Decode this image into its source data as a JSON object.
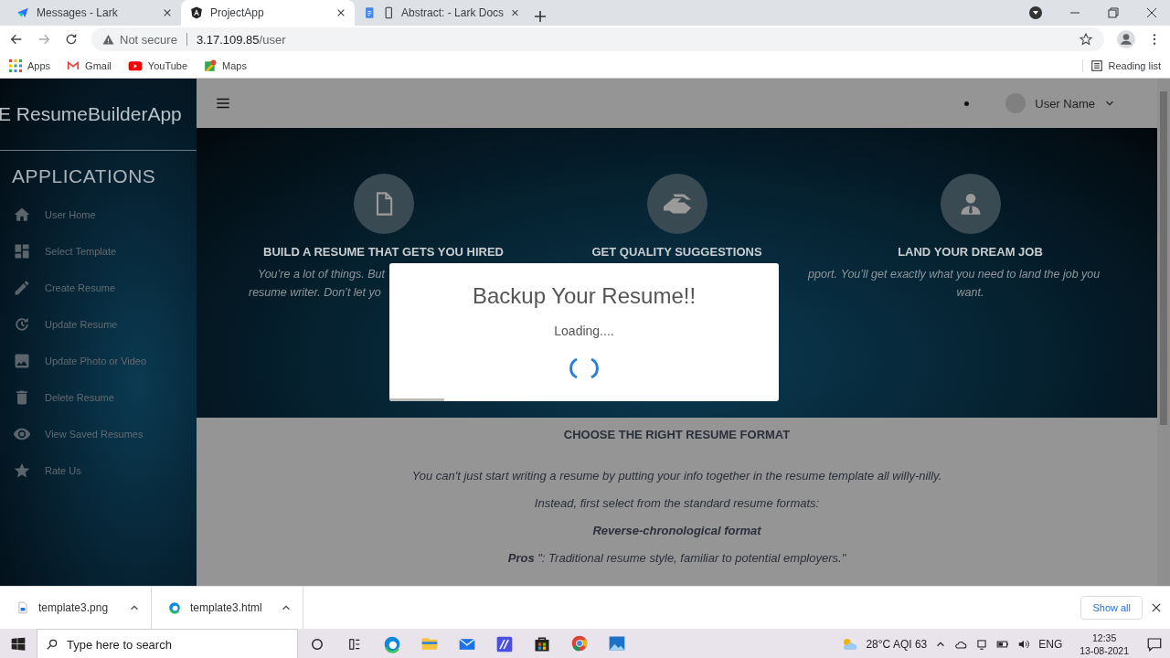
{
  "browser": {
    "tabs": [
      {
        "title": "Messages - Lark",
        "selected": false
      },
      {
        "title": "ProjectApp",
        "selected": true
      },
      {
        "title": "Abstract: - Lark Docs",
        "selected": false
      }
    ],
    "address": {
      "security": "Not secure",
      "host": "3.17.109.85",
      "path": "/user"
    },
    "bookmarks": [
      "Apps",
      "Gmail",
      "YouTube",
      "Maps"
    ],
    "reading_list": "Reading list"
  },
  "app": {
    "brand": "E ResumeBuilderApp",
    "section": "APPLICATIONS",
    "menu": [
      "User Home",
      "Select Template",
      "Create Resume",
      "Update Resume",
      "Update Photo or Video",
      "Delete Resume",
      "View Saved Resumes",
      "Rate Us"
    ],
    "user": "User Name",
    "features": [
      {
        "title": "BUILD A RESUME THAT GETS YOU HIRED",
        "lines": [
          "You’re a lot of things. But",
          "resume writer. Don’t let yo"
        ]
      },
      {
        "title": "GET QUALITY SUGGESTIONS",
        "lines": [
          "pport."
        ]
      },
      {
        "title": "LAND YOUR DREAM JOB",
        "lines": [
          "You’ll get exactly what you need to land the job you",
          "want."
        ]
      }
    ],
    "content": [
      {
        "kind": "heading",
        "text": "CHOOSE THE RIGHT RESUME FORMAT"
      },
      {
        "kind": "text",
        "text": "You can't just start writing a resume by putting your info together in the resume template all willy-nilly."
      },
      {
        "kind": "text",
        "text": "Instead, first select from the standard resume formats:"
      },
      {
        "kind": "subheading",
        "text": "Reverse-chronological format"
      },
      {
        "kind": "text",
        "text": "**Pros** \": Traditional resume style, familiar to potential employers.\""
      }
    ],
    "modal": {
      "title": "Backup Your Resume!!",
      "message": "Loading....",
      "level": 0.14
    }
  },
  "downloads": {
    "files": [
      "template3.png",
      "template3.html"
    ],
    "show_all": "Show all"
  },
  "taskbar": {
    "search_placeholder": "Type here to search",
    "weather": "28°C AQI 63",
    "language": "ENG",
    "time": "12:35",
    "date": "13-08-2021"
  }
}
